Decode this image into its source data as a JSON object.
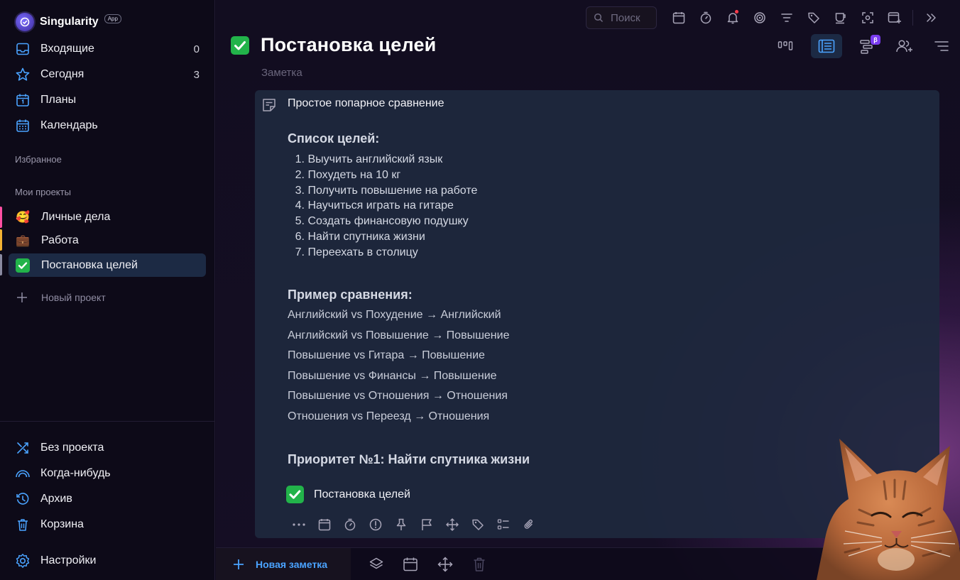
{
  "app": {
    "name": "Singularity",
    "badge": "App"
  },
  "sidebar": {
    "nav": [
      {
        "label": "Входящие",
        "count": "0",
        "icon": "inbox-icon"
      },
      {
        "label": "Сегодня",
        "count": "3",
        "icon": "star-icon"
      },
      {
        "label": "Планы",
        "count": "",
        "icon": "plans-calendar-icon"
      },
      {
        "label": "Календарь",
        "count": "",
        "icon": "calendar-icon"
      }
    ],
    "favorites_title": "Избранное",
    "projects_title": "Мои проекты",
    "projects": [
      {
        "label": "Личные дела",
        "emoji": "🥰",
        "bar_color": "#ff4fa3"
      },
      {
        "label": "Работа",
        "emoji": "💼",
        "bar_color": "#f3b233"
      },
      {
        "label": "Постановка целей",
        "emoji": "✅",
        "bar_color": "#8a8aa0"
      }
    ],
    "new_project": "Новый проект",
    "bottom_nav": [
      {
        "label": "Без проекта",
        "icon": "no-project-icon"
      },
      {
        "label": "Когда-нибудь",
        "icon": "someday-icon"
      },
      {
        "label": "Архив",
        "icon": "archive-icon"
      },
      {
        "label": "Корзина",
        "icon": "trash-icon"
      }
    ],
    "settings": "Настройки"
  },
  "toolbar": {
    "search_placeholder": "Поиск"
  },
  "page": {
    "title": "Постановка целей",
    "subtitle": "Заметка"
  },
  "note": {
    "header": "Простое попарное сравнение",
    "goals_title": "Список целей:",
    "goals": [
      {
        "n": "1.",
        "text": "Выучить английский язык"
      },
      {
        "n": "2.",
        "text": "Похудеть на 10 кг"
      },
      {
        "n": "3.",
        "text": "Получить повышение на работе"
      },
      {
        "n": "4.",
        "text": "Научиться играть на гитаре"
      },
      {
        "n": "5.",
        "text": "Создать финансовую подушку"
      },
      {
        "n": "6.",
        "text": "Найти спутника жизни"
      },
      {
        "n": "7.",
        "text": "Переехать в столицу"
      }
    ],
    "example_title": "Пример сравнения:",
    "comparisons": [
      "Английский vs Похудение → Английский",
      "Английский vs Повышение → Повышение",
      "Повышение vs Гитара → Повышение",
      "Повышение vs Финансы → Повышение",
      "Повышение vs Отношения → Отношения",
      "Отношения vs Переезд → Отношения"
    ],
    "priority": "Приоритет №1: Найти спутника жизни",
    "subtask": "Постановка целей"
  },
  "bottombar": {
    "new_note": "Новая заметка"
  },
  "colors": {
    "accent": "#4aa3ff",
    "active_bg": "#1c2a44",
    "check_green": "#22b34a",
    "beta": "#7a3cf0"
  }
}
